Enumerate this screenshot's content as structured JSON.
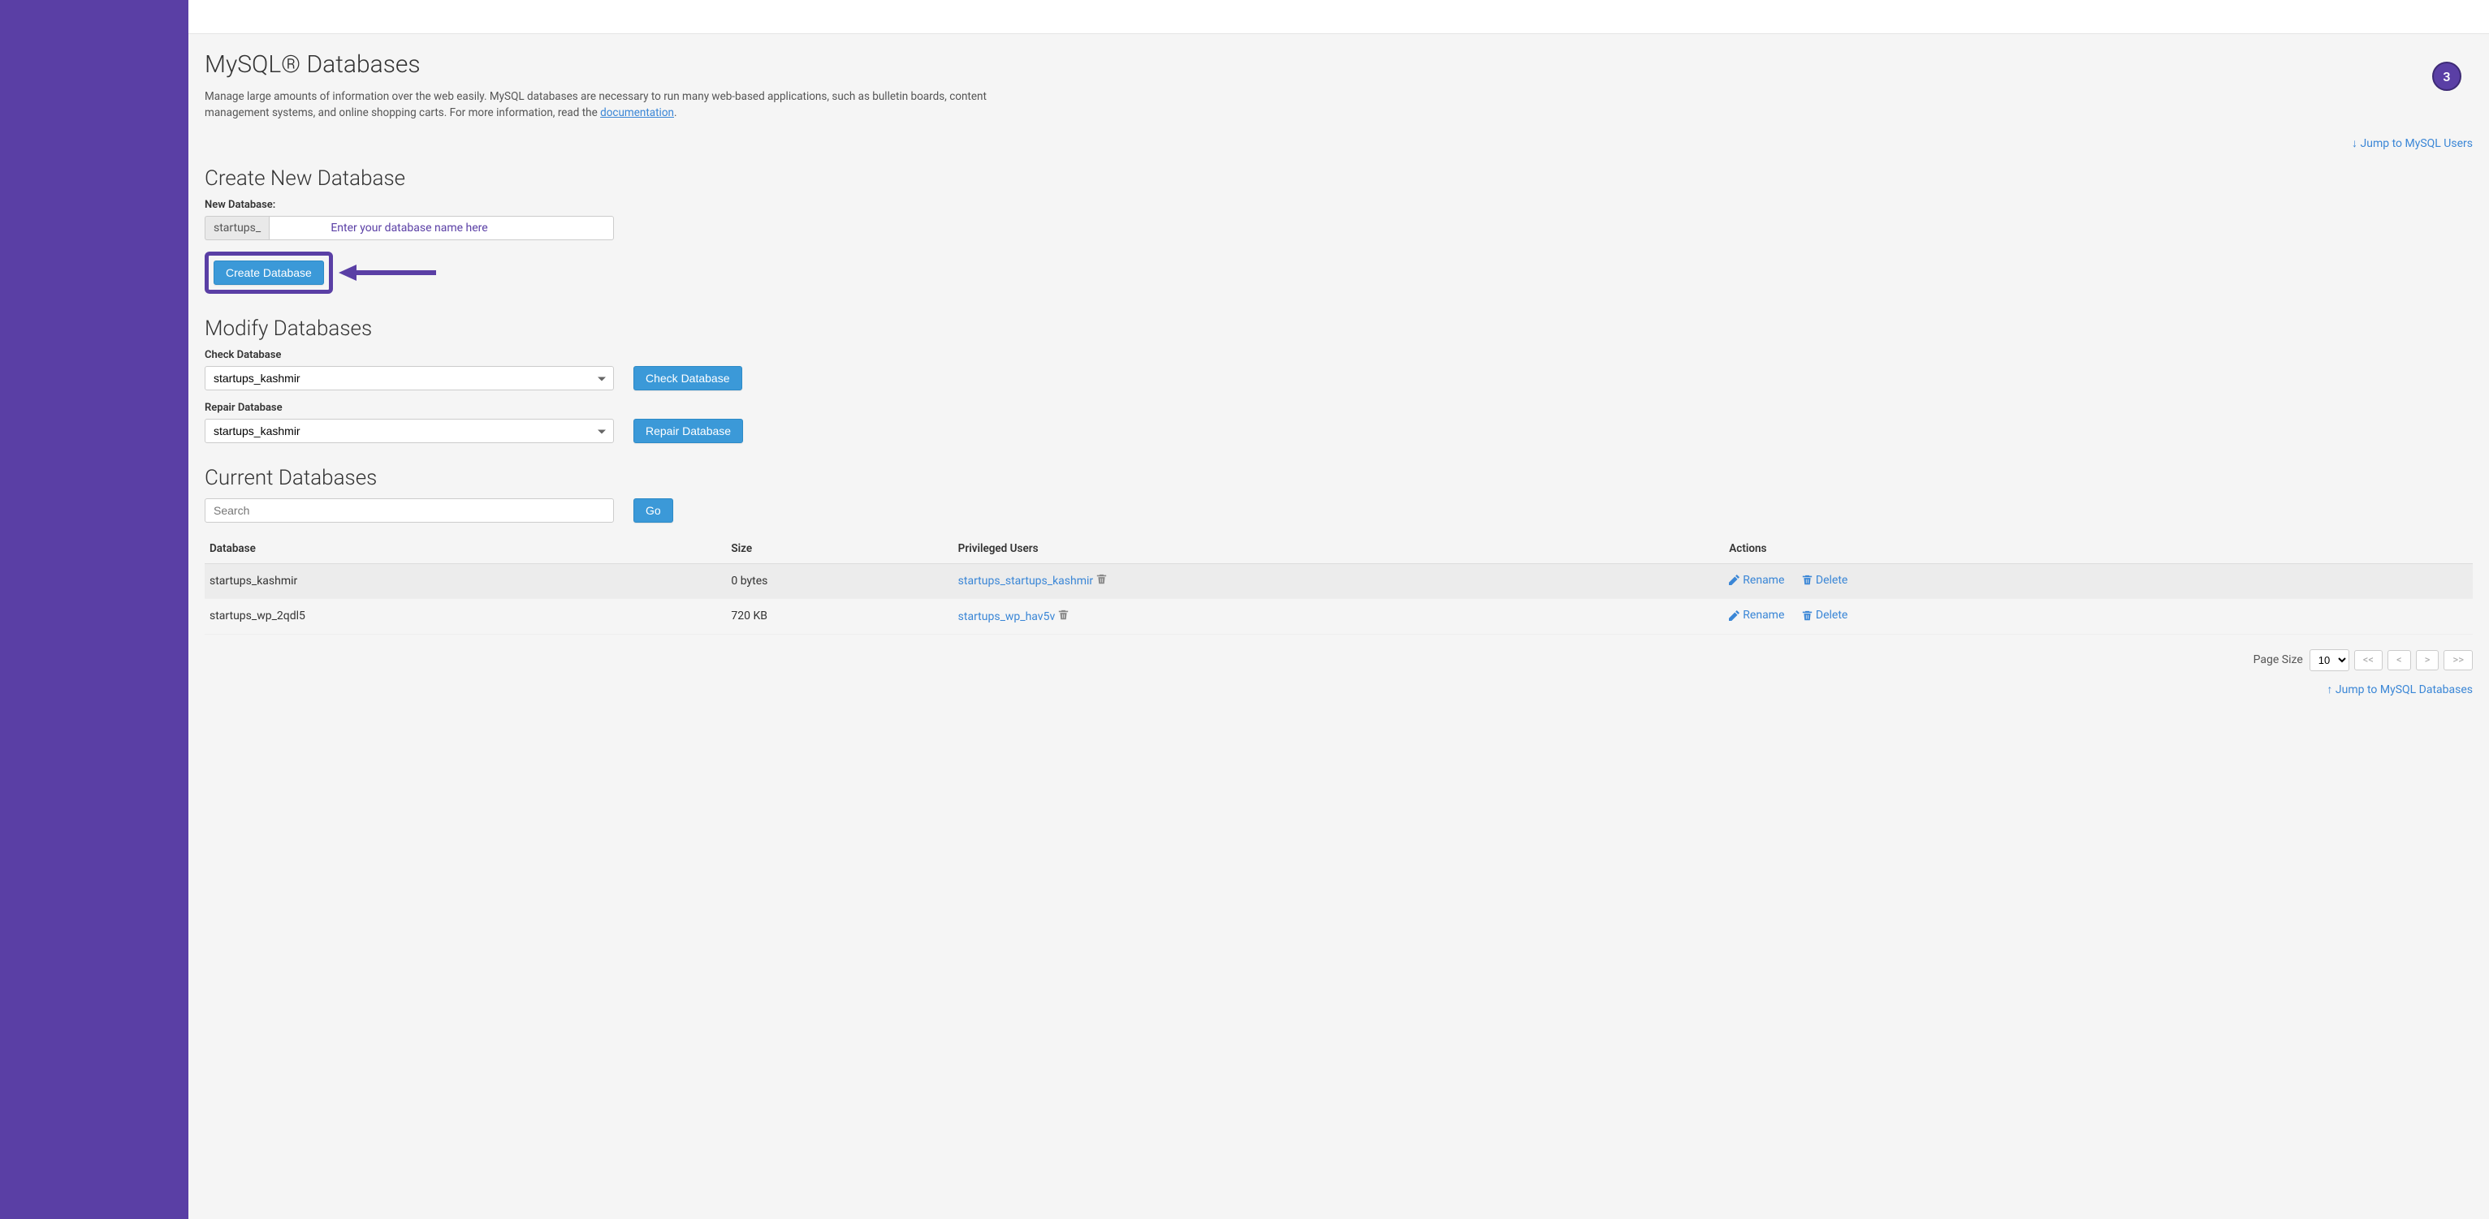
{
  "badge_number": "3",
  "page": {
    "title": "MySQL® Databases",
    "desc_before_link": "Manage large amounts of information over the web easily. MySQL databases are necessary to run many web-based applications, such as bulletin boards, content management systems, and online shopping carts. For more information, read the ",
    "doc_link_text": "documentation",
    "desc_after_link": "."
  },
  "jump_users_link": "Jump to MySQL Users",
  "jump_databases_link": "Jump to MySQL Databases",
  "create": {
    "heading": "Create New Database",
    "label": "New Database:",
    "prefix": "startups_",
    "hint": "Enter your database name here",
    "button": "Create Database"
  },
  "modify": {
    "heading": "Modify Databases",
    "check_label": "Check Database",
    "check_value": "startups_kashmir",
    "check_button": "Check Database",
    "repair_label": "Repair Database",
    "repair_value": "startups_kashmir",
    "repair_button": "Repair Database"
  },
  "current": {
    "heading": "Current Databases",
    "search_placeholder": "Search",
    "go_button": "Go",
    "columns": {
      "db": "Database",
      "size": "Size",
      "users": "Privileged Users",
      "actions": "Actions"
    },
    "rows": [
      {
        "db": "startups_kashmir",
        "size": "0 bytes",
        "user": "startups_startups_kashmir"
      },
      {
        "db": "startups_wp_2qdl5",
        "size": "720 KB",
        "user": "startups_wp_hav5v"
      }
    ],
    "rename_label": "Rename",
    "delete_label": "Delete"
  },
  "pager": {
    "label": "Page Size",
    "value": "10",
    "first": "<<",
    "prev": "<",
    "next": ">",
    "last": ">>"
  }
}
